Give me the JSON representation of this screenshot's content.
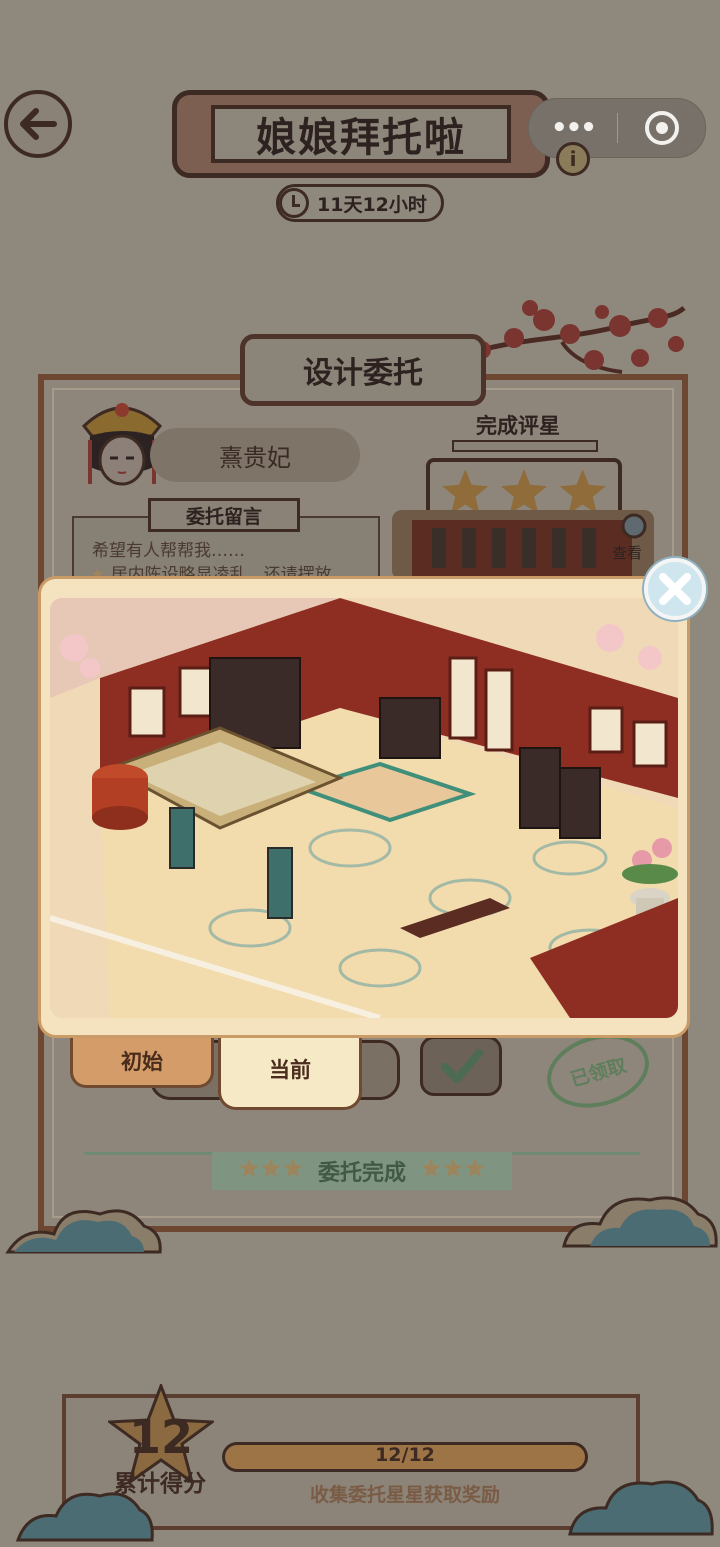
{
  "header": {
    "title": "娘娘拜托啦",
    "countdown": "11天12小时",
    "info_glyph": "i"
  },
  "card": {
    "title": "设计委托",
    "client_name": "熹贵妃",
    "message_tag": "委托留言",
    "message_lines": [
      "希望有人帮帮我……",
      "居内陈设略显凌乱，还请摆放"
    ],
    "rating_label": "完成评星",
    "stars_earned": 3,
    "stars_total": 3,
    "view_label": "查看",
    "tabs": [
      "初始",
      "当前"
    ],
    "active_tab": "当前",
    "claimed_stamp": "已领取",
    "complete_label": "委托完成"
  },
  "progress": {
    "score": "12",
    "score_label": "累计得分",
    "text": "12/12",
    "fraction": 1.0,
    "hint": "收集委托星星获取奖励"
  },
  "icons": [
    "back-arrow-icon",
    "more-dots-icon",
    "capsule-close-icon",
    "info-icon",
    "clock-icon",
    "star-icon",
    "magnifier-icon",
    "close-icon",
    "checkmark-icon"
  ],
  "colors": {
    "overlay": "#8f887c",
    "popup_bg": "#f4e3be",
    "wood": "#6e4733",
    "close_btn": "#cfe6ee",
    "active_tab": "#f6e9c6",
    "inactive_tab": "#d39c69"
  }
}
